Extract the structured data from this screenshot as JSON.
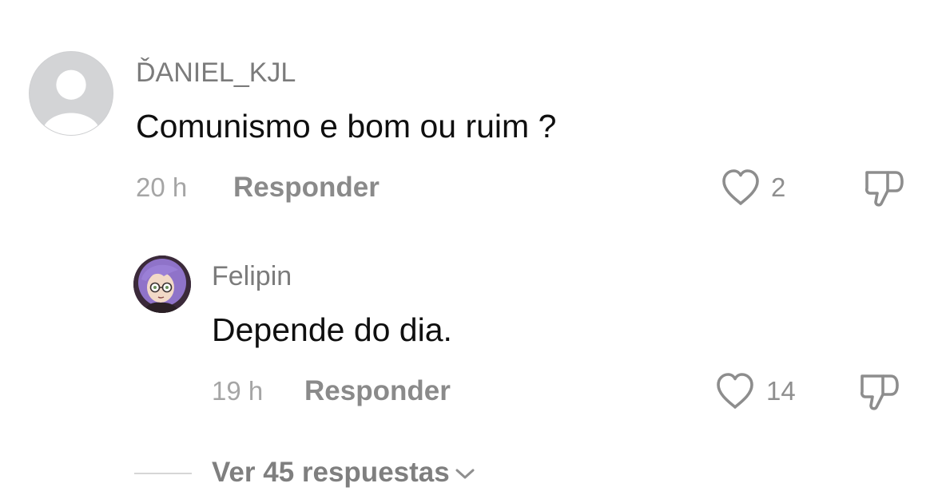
{
  "comments": [
    {
      "username": "ĎANIEL_KJL",
      "text": "Comunismo e bom ou ruim ?",
      "time": "20 h",
      "reply_label": "Responder",
      "likes": "2",
      "avatar": "default-user-avatar",
      "replies": [
        {
          "username": "Felipin",
          "text": "Depende do dia.",
          "time": "19 h",
          "reply_label": "Responder",
          "likes": "14",
          "avatar": "purple-hair-cartoon-avatar"
        }
      ]
    }
  ],
  "view_replies_label": "Ver 45 respuestas",
  "icons": {
    "like": "heart-outline-icon",
    "dislike": "thumbs-down-outline-icon",
    "expand": "chevron-down-icon"
  },
  "colors": {
    "username": "#7b7b7b",
    "text": "#0f0f0f",
    "meta": "#a5a5a5",
    "action": "#8a8a8a"
  }
}
